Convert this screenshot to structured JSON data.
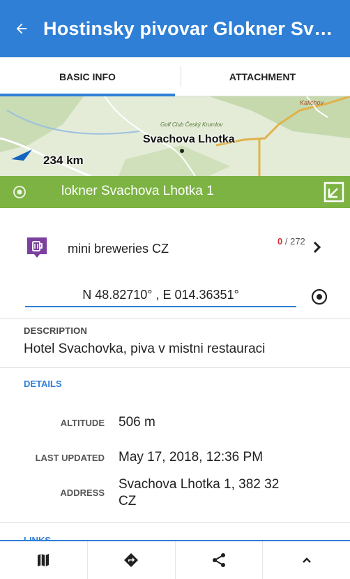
{
  "appbar": {
    "title": "Hostinsky pivovar Glokner Sva...",
    "back_icon": "arrow-back-icon"
  },
  "tabs": [
    {
      "label": "BASIC INFO",
      "active": true
    },
    {
      "label": "ATTACHMENT",
      "active": false
    }
  ],
  "map": {
    "place_label": "Svachova Lhotka",
    "small_label_top": "Kalichov",
    "golf_label": "Golf Club Český Krumlov",
    "distance": "234 km"
  },
  "greenbar": {
    "name": "lokner Svachova Lhotka 1",
    "color": "#7cb342"
  },
  "category": {
    "label": "mini breweries CZ",
    "count_current": "0",
    "count_total": "/ 272",
    "icon": "beer-icon",
    "icon_color": "#7b3fa0"
  },
  "coordinates": {
    "value": "N 48.82710° , E 014.36351°"
  },
  "description": {
    "label": "DESCRIPTION",
    "text": "Hotel Svachovka, piva v mistni restauraci"
  },
  "details": {
    "label": "DETAILS",
    "rows": [
      {
        "key": "ALTITUDE",
        "value": "506 m"
      },
      {
        "key": "LAST UPDATED",
        "value": "May 17, 2018, 12:36 PM"
      },
      {
        "key": "ADDRESS",
        "value_line1": "Svachova Lhotka 1, 382 32",
        "value_line2": "CZ"
      }
    ]
  },
  "links": {
    "label": "LINKS"
  },
  "bottom_nav": [
    {
      "icon": "map-icon"
    },
    {
      "icon": "navigate-icon"
    },
    {
      "icon": "share-icon"
    },
    {
      "icon": "chevron-up-icon"
    }
  ],
  "colors": {
    "primary": "#2f7fd6",
    "accent_red": "#d32f2f"
  }
}
